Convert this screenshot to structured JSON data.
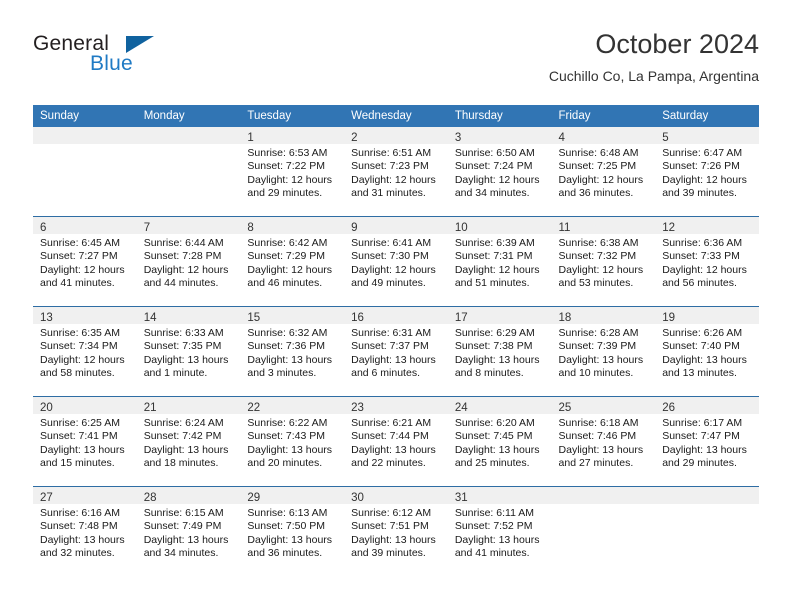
{
  "brand": {
    "name_part1": "General",
    "name_part2": "Blue",
    "logo_icon": "triangle-flag-icon",
    "accent_color": "#1f7ac4",
    "dark_color": "#231f20"
  },
  "header": {
    "title": "October 2024",
    "subtitle": "Cuchillo Co, La Pampa, Argentina"
  },
  "theme": {
    "header_bg": "#3175b4",
    "row_rule": "#2e6da4",
    "daynum_strip": "#f0f0f0"
  },
  "calendar": {
    "weekday_headers": [
      "Sunday",
      "Monday",
      "Tuesday",
      "Wednesday",
      "Thursday",
      "Friday",
      "Saturday"
    ],
    "weeks": [
      [
        {
          "day": "",
          "lines": []
        },
        {
          "day": "",
          "lines": []
        },
        {
          "day": "1",
          "lines": [
            "Sunrise: 6:53 AM",
            "Sunset: 7:22 PM",
            "Daylight: 12 hours",
            "and 29 minutes."
          ]
        },
        {
          "day": "2",
          "lines": [
            "Sunrise: 6:51 AM",
            "Sunset: 7:23 PM",
            "Daylight: 12 hours",
            "and 31 minutes."
          ]
        },
        {
          "day": "3",
          "lines": [
            "Sunrise: 6:50 AM",
            "Sunset: 7:24 PM",
            "Daylight: 12 hours",
            "and 34 minutes."
          ]
        },
        {
          "day": "4",
          "lines": [
            "Sunrise: 6:48 AM",
            "Sunset: 7:25 PM",
            "Daylight: 12 hours",
            "and 36 minutes."
          ]
        },
        {
          "day": "5",
          "lines": [
            "Sunrise: 6:47 AM",
            "Sunset: 7:26 PM",
            "Daylight: 12 hours",
            "and 39 minutes."
          ]
        }
      ],
      [
        {
          "day": "6",
          "lines": [
            "Sunrise: 6:45 AM",
            "Sunset: 7:27 PM",
            "Daylight: 12 hours",
            "and 41 minutes."
          ]
        },
        {
          "day": "7",
          "lines": [
            "Sunrise: 6:44 AM",
            "Sunset: 7:28 PM",
            "Daylight: 12 hours",
            "and 44 minutes."
          ]
        },
        {
          "day": "8",
          "lines": [
            "Sunrise: 6:42 AM",
            "Sunset: 7:29 PM",
            "Daylight: 12 hours",
            "and 46 minutes."
          ]
        },
        {
          "day": "9",
          "lines": [
            "Sunrise: 6:41 AM",
            "Sunset: 7:30 PM",
            "Daylight: 12 hours",
            "and 49 minutes."
          ]
        },
        {
          "day": "10",
          "lines": [
            "Sunrise: 6:39 AM",
            "Sunset: 7:31 PM",
            "Daylight: 12 hours",
            "and 51 minutes."
          ]
        },
        {
          "day": "11",
          "lines": [
            "Sunrise: 6:38 AM",
            "Sunset: 7:32 PM",
            "Daylight: 12 hours",
            "and 53 minutes."
          ]
        },
        {
          "day": "12",
          "lines": [
            "Sunrise: 6:36 AM",
            "Sunset: 7:33 PM",
            "Daylight: 12 hours",
            "and 56 minutes."
          ]
        }
      ],
      [
        {
          "day": "13",
          "lines": [
            "Sunrise: 6:35 AM",
            "Sunset: 7:34 PM",
            "Daylight: 12 hours",
            "and 58 minutes."
          ]
        },
        {
          "day": "14",
          "lines": [
            "Sunrise: 6:33 AM",
            "Sunset: 7:35 PM",
            "Daylight: 13 hours",
            "and 1 minute."
          ]
        },
        {
          "day": "15",
          "lines": [
            "Sunrise: 6:32 AM",
            "Sunset: 7:36 PM",
            "Daylight: 13 hours",
            "and 3 minutes."
          ]
        },
        {
          "day": "16",
          "lines": [
            "Sunrise: 6:31 AM",
            "Sunset: 7:37 PM",
            "Daylight: 13 hours",
            "and 6 minutes."
          ]
        },
        {
          "day": "17",
          "lines": [
            "Sunrise: 6:29 AM",
            "Sunset: 7:38 PM",
            "Daylight: 13 hours",
            "and 8 minutes."
          ]
        },
        {
          "day": "18",
          "lines": [
            "Sunrise: 6:28 AM",
            "Sunset: 7:39 PM",
            "Daylight: 13 hours",
            "and 10 minutes."
          ]
        },
        {
          "day": "19",
          "lines": [
            "Sunrise: 6:26 AM",
            "Sunset: 7:40 PM",
            "Daylight: 13 hours",
            "and 13 minutes."
          ]
        }
      ],
      [
        {
          "day": "20",
          "lines": [
            "Sunrise: 6:25 AM",
            "Sunset: 7:41 PM",
            "Daylight: 13 hours",
            "and 15 minutes."
          ]
        },
        {
          "day": "21",
          "lines": [
            "Sunrise: 6:24 AM",
            "Sunset: 7:42 PM",
            "Daylight: 13 hours",
            "and 18 minutes."
          ]
        },
        {
          "day": "22",
          "lines": [
            "Sunrise: 6:22 AM",
            "Sunset: 7:43 PM",
            "Daylight: 13 hours",
            "and 20 minutes."
          ]
        },
        {
          "day": "23",
          "lines": [
            "Sunrise: 6:21 AM",
            "Sunset: 7:44 PM",
            "Daylight: 13 hours",
            "and 22 minutes."
          ]
        },
        {
          "day": "24",
          "lines": [
            "Sunrise: 6:20 AM",
            "Sunset: 7:45 PM",
            "Daylight: 13 hours",
            "and 25 minutes."
          ]
        },
        {
          "day": "25",
          "lines": [
            "Sunrise: 6:18 AM",
            "Sunset: 7:46 PM",
            "Daylight: 13 hours",
            "and 27 minutes."
          ]
        },
        {
          "day": "26",
          "lines": [
            "Sunrise: 6:17 AM",
            "Sunset: 7:47 PM",
            "Daylight: 13 hours",
            "and 29 minutes."
          ]
        }
      ],
      [
        {
          "day": "27",
          "lines": [
            "Sunrise: 6:16 AM",
            "Sunset: 7:48 PM",
            "Daylight: 13 hours",
            "and 32 minutes."
          ]
        },
        {
          "day": "28",
          "lines": [
            "Sunrise: 6:15 AM",
            "Sunset: 7:49 PM",
            "Daylight: 13 hours",
            "and 34 minutes."
          ]
        },
        {
          "day": "29",
          "lines": [
            "Sunrise: 6:13 AM",
            "Sunset: 7:50 PM",
            "Daylight: 13 hours",
            "and 36 minutes."
          ]
        },
        {
          "day": "30",
          "lines": [
            "Sunrise: 6:12 AM",
            "Sunset: 7:51 PM",
            "Daylight: 13 hours",
            "and 39 minutes."
          ]
        },
        {
          "day": "31",
          "lines": [
            "Sunrise: 6:11 AM",
            "Sunset: 7:52 PM",
            "Daylight: 13 hours",
            "and 41 minutes."
          ]
        },
        {
          "day": "",
          "lines": []
        },
        {
          "day": "",
          "lines": []
        }
      ]
    ]
  }
}
